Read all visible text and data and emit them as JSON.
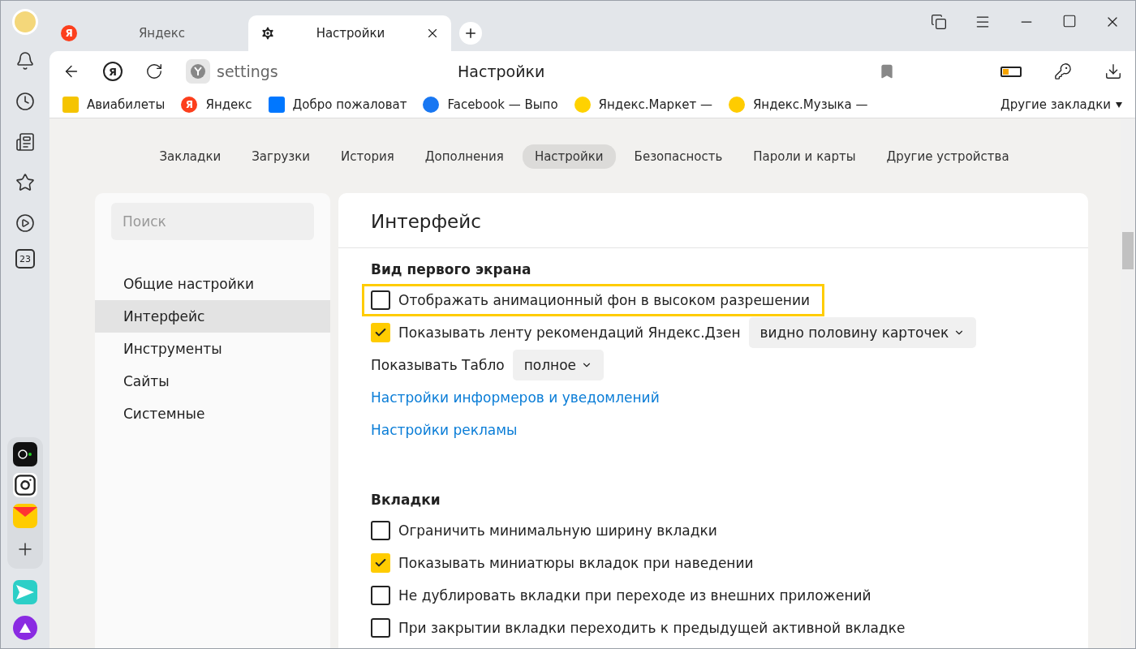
{
  "sidebar": {
    "calendar_day": "23"
  },
  "tabs": [
    {
      "title": "Яндекс",
      "kind": "site",
      "letter": "Я",
      "selected": false
    },
    {
      "title": "Настройки",
      "kind": "settings",
      "selected": true
    }
  ],
  "toolbar": {
    "home_letter": "Я",
    "address": "settings",
    "page_title": "Настройки"
  },
  "bookmarks": [
    {
      "kind": "avia",
      "label": "Авиабилеты"
    },
    {
      "kind": "letter",
      "letter": "Я",
      "label": "Яндекс"
    },
    {
      "kind": "vk",
      "label": "Добро пожаловат"
    },
    {
      "kind": "facebook",
      "label": "Facebook — Выпо"
    },
    {
      "kind": "market",
      "label": "Яндекс.Маркет —"
    },
    {
      "kind": "music",
      "label": "Яндекс.Музыка —"
    }
  ],
  "other_bookmarks": "Другие закладки",
  "nav": [
    {
      "label": "Закладки",
      "selected": false
    },
    {
      "label": "Загрузки",
      "selected": false
    },
    {
      "label": "История",
      "selected": false
    },
    {
      "label": "Дополнения",
      "selected": false
    },
    {
      "label": "Настройки",
      "selected": true
    },
    {
      "label": "Безопасность",
      "selected": false
    },
    {
      "label": "Пароли и карты",
      "selected": false
    },
    {
      "label": "Другие устройства",
      "selected": false
    }
  ],
  "search": {
    "placeholder": "Поиск"
  },
  "menu": [
    {
      "label": "Общие настройки",
      "selected": false
    },
    {
      "label": "Интерфейс",
      "selected": true
    },
    {
      "label": "Инструменты",
      "selected": false
    },
    {
      "label": "Сайты",
      "selected": false
    },
    {
      "label": "Системные",
      "selected": false
    }
  ],
  "panel": {
    "title": "Интерфейс",
    "sections": [
      {
        "title": "Вид первого экрана",
        "rows": [
          {
            "kind": "checkbox",
            "label": "Отображать анимационный фон в высоком разрешении",
            "checked": false,
            "highlighted": true
          },
          {
            "kind": "checkbox",
            "label": "Показывать ленту рекомендаций Яндекс.Дзен",
            "checked": true,
            "highlighted": false,
            "dropdown": "видно половину карточек"
          },
          {
            "kind": "select",
            "label": "Показывать Табло",
            "dropdown": "полное"
          },
          {
            "kind": "link",
            "label": "Настройки информеров и уведомлений"
          },
          {
            "kind": "link",
            "label": "Настройки рекламы"
          }
        ]
      },
      {
        "title": "Вкладки",
        "rows": [
          {
            "kind": "checkbox",
            "label": "Ограничить минимальную ширину вкладки",
            "checked": false,
            "highlighted": false
          },
          {
            "kind": "checkbox",
            "label": "Показывать миниатюры вкладок при наведении",
            "checked": true,
            "highlighted": false
          },
          {
            "kind": "checkbox",
            "label": "Не дублировать вкладки при переходе из внешних приложений",
            "checked": false,
            "highlighted": false
          },
          {
            "kind": "checkbox",
            "label": "При закрытии вкладки переходить к предыдущей активной вкладке",
            "checked": false,
            "highlighted": false
          }
        ]
      }
    ]
  }
}
